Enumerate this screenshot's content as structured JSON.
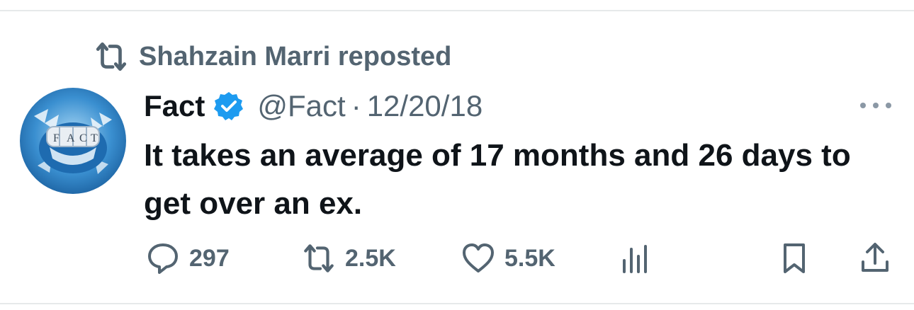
{
  "repost": {
    "icon": "repost-icon",
    "text": "Shahzain Marri reposted"
  },
  "tweet": {
    "avatar_text": "FACT",
    "display_name": "Fact",
    "verified": true,
    "handle": "@Fact",
    "separator": "·",
    "timestamp": "12/20/18",
    "text": "It takes an average of 17 months and 26 days to get over an ex."
  },
  "actions": {
    "replies": "297",
    "reposts": "2.5K",
    "likes": "5.5K"
  },
  "colors": {
    "text_primary": "#0f1419",
    "text_secondary": "#536471",
    "verified_blue": "#1d9bf0",
    "divider": "#e6e9ea"
  }
}
